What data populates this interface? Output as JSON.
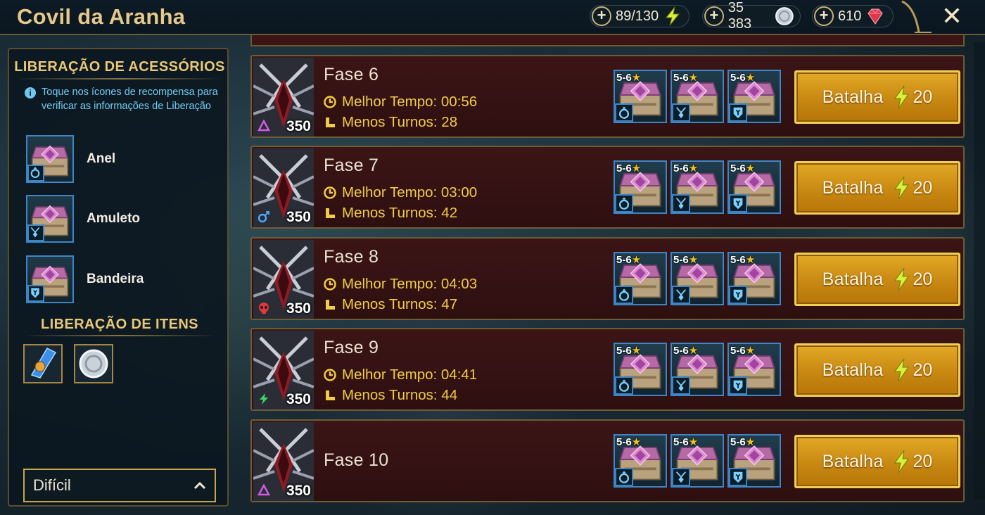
{
  "header": {
    "title": "Covil da Aranha",
    "energy": "89/130",
    "silver": "35 383",
    "gems": "610",
    "close_label": "✕"
  },
  "left_panel": {
    "accessories_title": "LIBERAÇÃO DE ACESSÓRIOS",
    "info_text": "Toque nos ícones de recompensa para verificar as informações de Liberação",
    "accessories": [
      {
        "label": "Anel",
        "icon": "ring-icon"
      },
      {
        "label": "Amuleto",
        "icon": "amulet-icon"
      },
      {
        "label": "Bandeira",
        "icon": "banner-icon"
      }
    ],
    "items_title": "LIBERAÇÃO DE ITENS",
    "items": [
      {
        "icon": "shard-icon"
      },
      {
        "icon": "silver-coin-icon"
      }
    ],
    "difficulty": "Difícil"
  },
  "stages": [
    {
      "name": "Fase 6",
      "level": "350",
      "affinity": "void",
      "best_time_label": "Melhor Tempo: 00:56",
      "min_turns_label": "Menos Turnos: 28",
      "rewards": [
        "5-6",
        "5-6",
        "5-6"
      ],
      "battle_label": "Batalha",
      "cost": "20"
    },
    {
      "name": "Fase 7",
      "level": "350",
      "affinity": "magic",
      "best_time_label": "Melhor Tempo: 03:00",
      "min_turns_label": "Menos Turnos: 42",
      "rewards": [
        "5-6",
        "5-6",
        "5-6"
      ],
      "battle_label": "Batalha",
      "cost": "20"
    },
    {
      "name": "Fase 8",
      "level": "350",
      "affinity": "force",
      "best_time_label": "Melhor Tempo: 04:03",
      "min_turns_label": "Menos Turnos: 47",
      "rewards": [
        "5-6",
        "5-6",
        "5-6"
      ],
      "battle_label": "Batalha",
      "cost": "20"
    },
    {
      "name": "Fase 9",
      "level": "350",
      "affinity": "spirit",
      "best_time_label": "Melhor Tempo: 04:41",
      "min_turns_label": "Menos Turnos: 44",
      "rewards": [
        "5-6",
        "5-6",
        "5-6"
      ],
      "battle_label": "Batalha",
      "cost": "20"
    },
    {
      "name": "Fase 10",
      "level": "350",
      "affinity": "void",
      "best_time_label": "",
      "min_turns_label": "",
      "rewards": [
        "5-6",
        "5-6",
        "5-6"
      ],
      "battle_label": "Batalha",
      "cost": "20"
    }
  ],
  "reward_accessories": [
    "ring-icon",
    "amulet-icon",
    "banner-icon"
  ],
  "colors": {
    "gold": "#e8c877",
    "stat_yellow": "#f1cd45",
    "info_blue": "#74ccf2",
    "battle_orange": "#d9980f",
    "row_red": "#3c1516"
  }
}
